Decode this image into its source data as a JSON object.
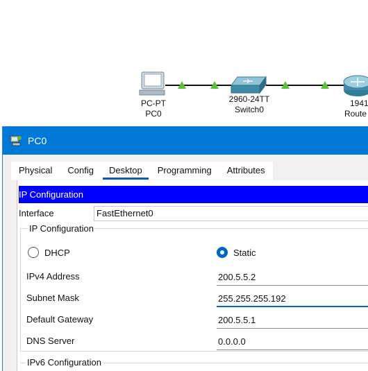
{
  "topology": {
    "devices": [
      {
        "model": "PC-PT",
        "name": "PC0",
        "icon": "pc-icon"
      },
      {
        "model": "2960-24TT",
        "name": "Switch0",
        "icon": "switch-icon"
      },
      {
        "model": "1941",
        "name": "Route",
        "icon": "router-icon"
      }
    ],
    "link_indicator_color": "#5cbf3a"
  },
  "window": {
    "title": "PC0",
    "icon": "pc-app-icon",
    "accent": "#0078d7"
  },
  "tabs": [
    {
      "label": "Physical"
    },
    {
      "label": "Config"
    },
    {
      "label": "Desktop",
      "active": true
    },
    {
      "label": "Programming"
    },
    {
      "label": "Attributes"
    }
  ],
  "ip_config": {
    "header": "IP Configuration",
    "header_color": "#0000ff",
    "interface_label": "Interface",
    "interface_value": "FastEthernet0",
    "ipv4_group_label": "IP Configuration",
    "dhcp_label": "DHCP",
    "static_label": "Static",
    "mode_selected": "Static",
    "fields": {
      "ipv4_label": "IPv4 Address",
      "ipv4_value": "200.5.5.2",
      "subnet_label": "Subnet Mask",
      "subnet_value": "255.255.255.192",
      "gateway_label": "Default Gateway",
      "gateway_value": "200.5.5.1",
      "dns_label": "DNS Server",
      "dns_value": "0.0.0.0"
    },
    "ipv6_group_label": "IPv6 Configuration"
  }
}
